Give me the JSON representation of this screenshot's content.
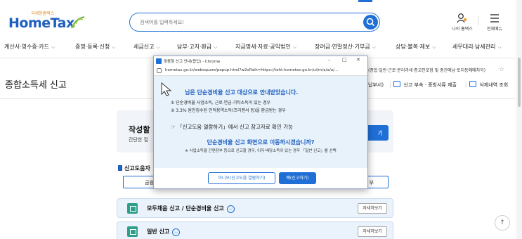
{
  "header": {
    "logo_small": "국세청홈택스",
    "logo_main": "HomeTax",
    "search_placeholder": "검색어를 입력하세요!",
    "my_hometax": "나의 홈택스",
    "all_menu": "전체메뉴"
  },
  "nav": {
    "items": [
      "계산서·영수증·카드",
      "증명·등록·신청",
      "세금신고",
      "납부·고지·환급",
      "지급명세·자료·공익법인",
      "장려금·연말정산·기부금",
      "상담·불복·제보",
      "세무대리·납세관리"
    ]
  },
  "page": {
    "title": "종합소득세 신고",
    "right_note": "(종합·일반·근로·분리과세·종교인포함 및 중간예납·토지등매매차익)",
    "links": [
      "신고 부속 · 증빙서류 제출",
      "삭제내역 조회"
    ],
    "partial_link": "납부서)"
  },
  "card": {
    "title": "작성할",
    "subtitle": "간단한 절",
    "button": "기"
  },
  "help": {
    "heading": "신고도움자",
    "tab_left": "금융",
    "tab_right": "부"
  },
  "rows": [
    {
      "title": "모두채움 신고 / 단순경비율 신고",
      "button": "자세히보기"
    },
    {
      "title": "일반 신고",
      "button": "자세히보기"
    }
  ],
  "popup": {
    "window_title": "맞춤형 신고 안내(팝업) - Chrome",
    "url": "hometax.go.kr/websquare/popup.html?w2xPath=https://teht.hometax.go.kr/ui/rn/a/a/a/...",
    "lead": "님은 단순경비율 신고 대상으로 안내받았습니다.",
    "items": [
      "① 단순경비율 사업소득, 근로·연금·기타소득이 있는 경우",
      "② 3.3% 원천징수된 인적용역소득(프리랜서 등)을 환급받는 경우"
    ],
    "note": "☞ 「신고도움 열람하기」에서 신고 참고자료 확인 가능",
    "question": "단순경비율 신고 화면으로 이동하시겠습니까?",
    "small": "※ 사업소득을 간편장부 등으로 신고할 경우, 이자·배당소득이 있는 경우 「일반 신고」를 선택",
    "btn_no": "아니오(신고도움 열람하기)",
    "btn_yes": "예(신고하기)"
  },
  "colors": {
    "primary": "#1f6fd6",
    "popup_body": "#e7f2fb",
    "row_bg": "#eaf2fb",
    "icon_teal": "#2e9f8a"
  }
}
